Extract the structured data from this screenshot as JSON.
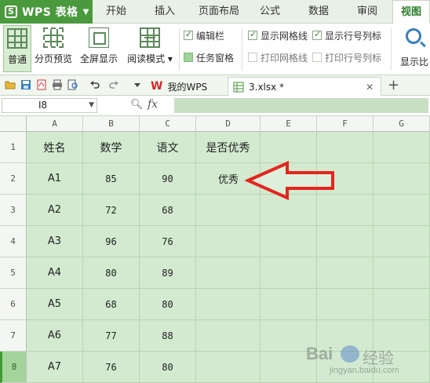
{
  "app": {
    "logo": "S",
    "name": "WPS 表格"
  },
  "ribbon_tabs": [
    "开始",
    "插入",
    "页面布局",
    "公式",
    "数据",
    "审阅",
    "视图"
  ],
  "active_tab": "视图",
  "view_buttons": [
    "普通",
    "分页预览",
    "全屏显示",
    "阅读模式"
  ],
  "checkboxes": {
    "edit_bar": {
      "label": "编辑栏",
      "checked": true
    },
    "task_pane": {
      "label": "任务窗格"
    },
    "show_gridlines": {
      "label": "显示网格线",
      "checked": true
    },
    "show_headers": {
      "label": "显示行号列标",
      "checked": true
    },
    "print_gridlines": {
      "label": "打印网格线",
      "checked": false
    },
    "print_headers": {
      "label": "打印行号列标",
      "checked": false
    }
  },
  "display_ratio_label": "显示比",
  "doc_tabs": [
    {
      "label": "我的WPS",
      "icon": "wps-logo-icon"
    },
    {
      "label": "3.xlsx *",
      "icon": "spreadsheet-file-icon"
    }
  ],
  "name_box": "I8",
  "fx_label": "fx",
  "columns": [
    "A",
    "B",
    "C",
    "D",
    "E",
    "F",
    "G"
  ],
  "rows": [
    "1",
    "2",
    "3",
    "4",
    "5",
    "6",
    "7",
    "8"
  ],
  "selected_row": "8",
  "table": {
    "headers": [
      "姓名",
      "数学",
      "语文",
      "是否优秀"
    ],
    "records": [
      [
        "A1",
        "85",
        "90",
        "优秀"
      ],
      [
        "A2",
        "72",
        "68",
        ""
      ],
      [
        "A3",
        "96",
        "76",
        ""
      ],
      [
        "A4",
        "80",
        "89",
        ""
      ],
      [
        "A5",
        "68",
        "80",
        ""
      ],
      [
        "A6",
        "77",
        "88",
        ""
      ],
      [
        "A7",
        "76",
        "80",
        ""
      ]
    ]
  },
  "annotation_color": "#e5251f",
  "accent_color": "#4a9a3d",
  "watermark": {
    "brand": "Bai",
    "cn": "经验",
    "url": "jingyan.baidu.com"
  }
}
